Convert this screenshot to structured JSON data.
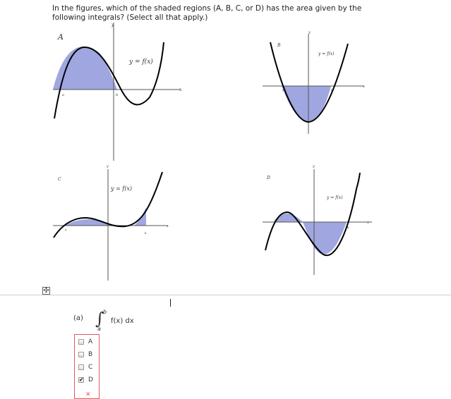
{
  "question": {
    "text": "In the figures, which of the shaded regions (A, B, C, or D) has the area given by the following integrals? (Select all that apply.)"
  },
  "figures": [
    {
      "letter": "A",
      "curve_label": "y = f(x)",
      "x_axis": "x",
      "y_axis": "y",
      "marks": [
        "a",
        "b"
      ]
    },
    {
      "letter": "B",
      "curve_label": "y = f(x)",
      "x_axis": "x",
      "y_axis": "y",
      "marks": [
        "a",
        "b"
      ]
    },
    {
      "letter": "C",
      "curve_label": "y = f(x)",
      "x_axis": "x",
      "y_axis": "y",
      "marks": [
        "a",
        "b"
      ]
    },
    {
      "letter": "D",
      "curve_label": "y = f(x)",
      "x_axis": "x",
      "y_axis": "y",
      "marks": [
        "a",
        "b"
      ]
    }
  ],
  "colors": {
    "shade": "#9fa6e0",
    "curve": "#000000",
    "axis": "#555555",
    "selection_border": "#e05a5a"
  },
  "move_handle_icon": "move-icon",
  "part": {
    "label": "(a)",
    "integral": {
      "upper": "b",
      "lower": "a",
      "expression": "f(x) dx"
    },
    "options": [
      {
        "label": "A",
        "checked": false
      },
      {
        "label": "B",
        "checked": false
      },
      {
        "label": "C",
        "checked": false
      },
      {
        "label": "D",
        "checked": true
      }
    ]
  }
}
